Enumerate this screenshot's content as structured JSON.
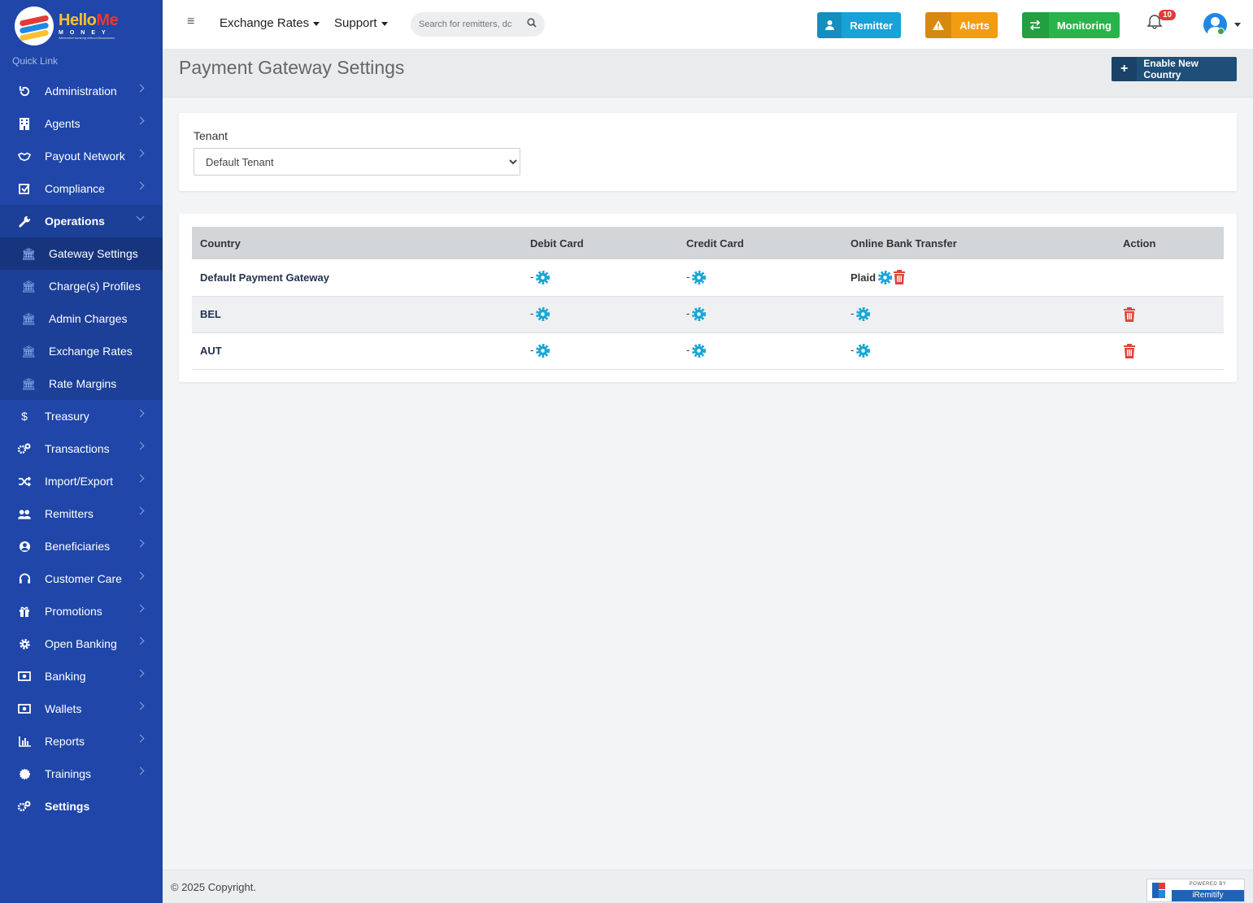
{
  "brand": {
    "name_part1": "Hello",
    "name_part2": "Me",
    "sub": "MONEY",
    "tagline": "Alternative banking without Boundaries"
  },
  "sidebar": {
    "quick_link": "Quick Link",
    "items": [
      {
        "label": "Administration",
        "icon": "refresh-icon"
      },
      {
        "label": "Agents",
        "icon": "building-icon"
      },
      {
        "label": "Payout Network",
        "icon": "handshake-icon"
      },
      {
        "label": "Compliance",
        "icon": "check-square-icon"
      },
      {
        "label": "Operations",
        "icon": "wrench-icon"
      }
    ],
    "sub_items": [
      {
        "label": "Gateway Settings",
        "icon": "bank-icon"
      },
      {
        "label": "Charge(s) Profiles",
        "icon": "bank-icon"
      },
      {
        "label": "Admin Charges",
        "icon": "bank-icon"
      },
      {
        "label": "Exchange Rates",
        "icon": "bank-icon"
      },
      {
        "label": "Rate Margins",
        "icon": "bank-icon"
      }
    ],
    "items_after": [
      {
        "label": "Treasury",
        "icon": "dollar-icon"
      },
      {
        "label": "Transactions",
        "icon": "cogs-icon"
      },
      {
        "label": "Import/Export",
        "icon": "shuffle-icon"
      },
      {
        "label": "Remitters",
        "icon": "users-icon"
      },
      {
        "label": "Beneficiaries",
        "icon": "user-circle-icon"
      },
      {
        "label": "Customer Care",
        "icon": "headset-icon"
      },
      {
        "label": "Promotions",
        "icon": "gift-icon"
      },
      {
        "label": "Open Banking",
        "icon": "gear-icon"
      },
      {
        "label": "Banking",
        "icon": "money-icon"
      },
      {
        "label": "Wallets",
        "icon": "money-icon"
      },
      {
        "label": "Reports",
        "icon": "bar-chart-icon"
      },
      {
        "label": "Trainings",
        "icon": "sun-icon"
      },
      {
        "label": "Settings",
        "icon": "cogs-icon"
      }
    ]
  },
  "topbar": {
    "menu_exchange": "Exchange Rates",
    "menu_support": "Support",
    "search_placeholder": "Search for remitters, dc",
    "btn_remitter": "Remitter",
    "btn_alerts": "Alerts",
    "btn_monitoring": "Monitoring",
    "notif_count": "10",
    "colors": {
      "remitter": "#17a2d8",
      "alerts": "#f39c12",
      "monitoring": "#28b44a"
    }
  },
  "page": {
    "title": "Payment Gateway Settings",
    "enable_btn": "Enable New Country",
    "tenant_label": "Tenant",
    "tenant_value": "Default Tenant"
  },
  "table": {
    "headers": [
      "Country",
      "Debit Card",
      "Credit Card",
      "Online Bank Transfer",
      "Action"
    ],
    "rows": [
      {
        "country": "Default Payment Gateway",
        "debit": "-",
        "credit": "-",
        "online": "Plaid"
      },
      {
        "country": "BEL",
        "debit": "-",
        "credit": "-",
        "online": "-"
      },
      {
        "country": "AUT",
        "debit": "-",
        "credit": "-",
        "online": "-"
      }
    ]
  },
  "footer": {
    "copyright": "© 2025 Copyright.",
    "powered_by": "POWERED BY",
    "powered_name": "iRemitify"
  }
}
